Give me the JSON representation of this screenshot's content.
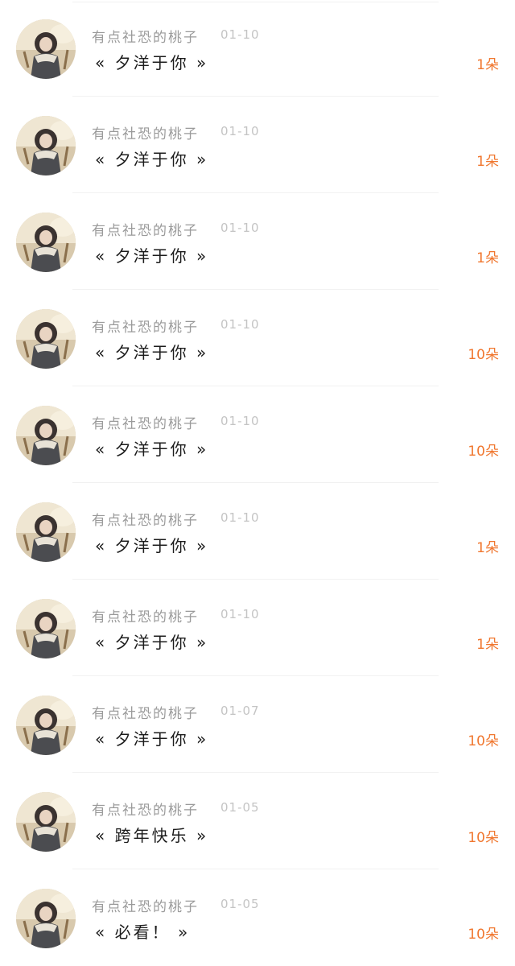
{
  "items": [
    {
      "name": "有点社恐的桃子",
      "date": "01-10",
      "title": "« 夕洋于你 »",
      "gift": "1朵"
    },
    {
      "name": "有点社恐的桃子",
      "date": "01-10",
      "title": "« 夕洋于你 »",
      "gift": "1朵"
    },
    {
      "name": "有点社恐的桃子",
      "date": "01-10",
      "title": "« 夕洋于你 »",
      "gift": "1朵"
    },
    {
      "name": "有点社恐的桃子",
      "date": "01-10",
      "title": "« 夕洋于你 »",
      "gift": "10朵"
    },
    {
      "name": "有点社恐的桃子",
      "date": "01-10",
      "title": "« 夕洋于你 »",
      "gift": "10朵"
    },
    {
      "name": "有点社恐的桃子",
      "date": "01-10",
      "title": "« 夕洋于你 »",
      "gift": "1朵"
    },
    {
      "name": "有点社恐的桃子",
      "date": "01-10",
      "title": "« 夕洋于你 »",
      "gift": "1朵"
    },
    {
      "name": "有点社恐的桃子",
      "date": "01-07",
      "title": "« 夕洋于你 »",
      "gift": "10朵"
    },
    {
      "name": "有点社恐的桃子",
      "date": "01-05",
      "title": "« 跨年快乐 »",
      "gift": "10朵"
    },
    {
      "name": "有点社恐的桃子",
      "date": "01-05",
      "title": "« 必看！ »",
      "gift": "10朵"
    }
  ],
  "colors": {
    "name": "#9a9a9a",
    "date": "#c4c4c4",
    "title": "#1c1c1c",
    "gift": "#f0772f",
    "divider": "#f1f1f1"
  },
  "avatar_icon": "user-avatar-girl-illustration"
}
